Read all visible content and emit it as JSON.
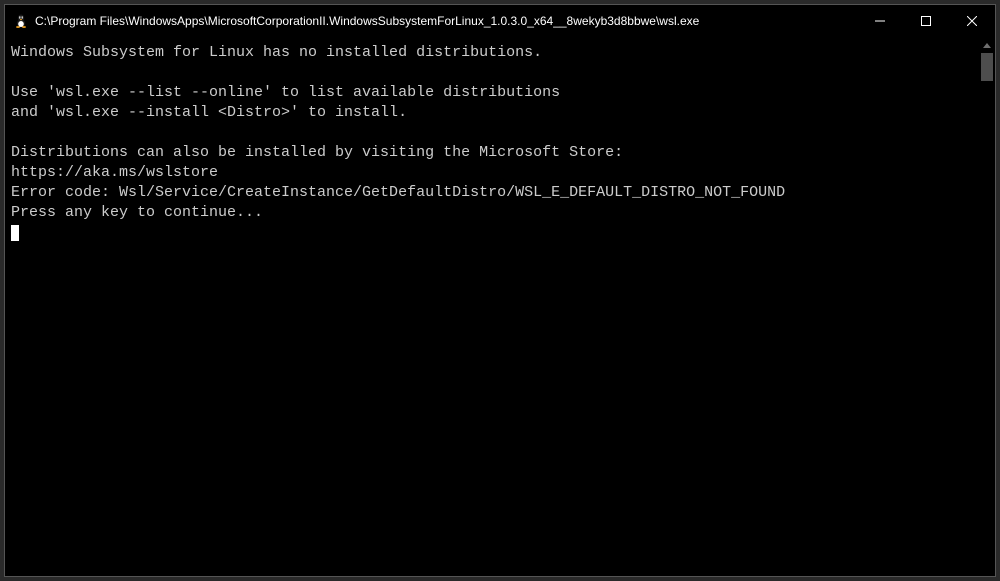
{
  "window": {
    "title": "C:\\Program Files\\WindowsApps\\MicrosoftCorporationII.WindowsSubsystemForLinux_1.0.3.0_x64__8wekyb3d8bbwe\\wsl.exe"
  },
  "terminal": {
    "lines": [
      "Windows Subsystem for Linux has no installed distributions.",
      "",
      "Use 'wsl.exe --list --online' to list available distributions",
      "and 'wsl.exe --install <Distro>' to install.",
      "",
      "Distributions can also be installed by visiting the Microsoft Store:",
      "https://aka.ms/wslstore",
      "Error code: Wsl/Service/CreateInstance/GetDefaultDistro/WSL_E_DEFAULT_DISTRO_NOT_FOUND",
      "Press any key to continue..."
    ]
  }
}
